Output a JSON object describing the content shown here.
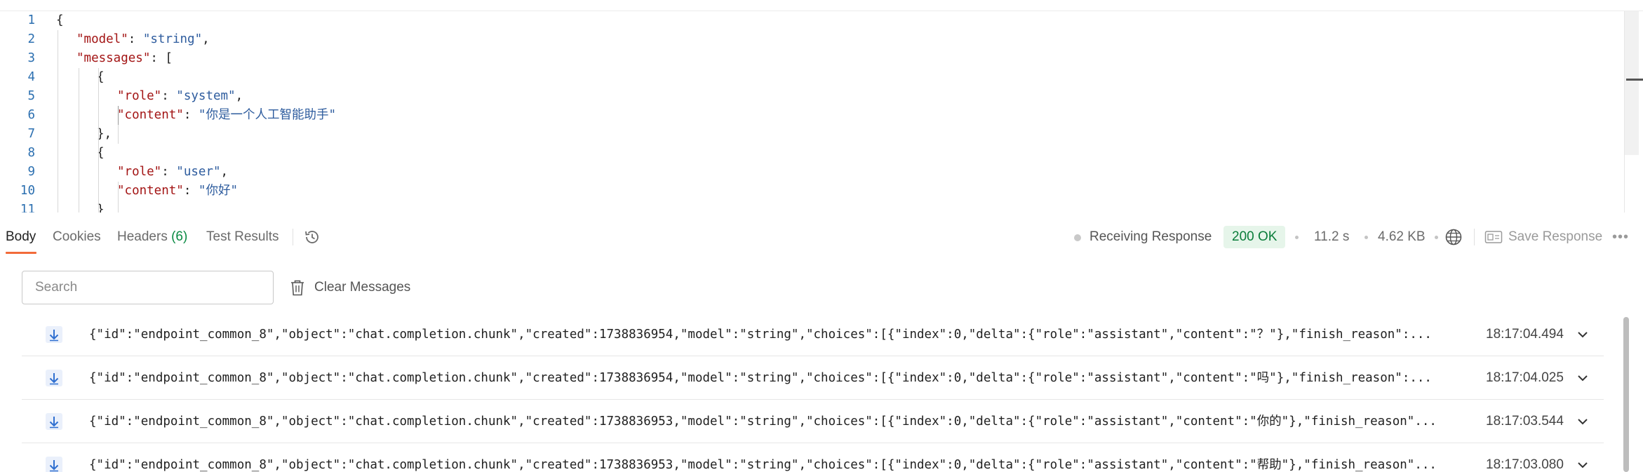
{
  "editor": {
    "lines": [
      {
        "n": "1",
        "parts": [
          {
            "t": "{",
            "c": "p"
          }
        ]
      },
      {
        "n": "2",
        "parts": [
          {
            "t": "\"model\"",
            "c": "k"
          },
          {
            "t": ": ",
            "c": "p"
          },
          {
            "t": "\"string\"",
            "c": "s"
          },
          {
            "t": ",",
            "c": "p"
          }
        ]
      },
      {
        "n": "3",
        "parts": [
          {
            "t": "\"messages\"",
            "c": "k"
          },
          {
            "t": ": [",
            "c": "p"
          }
        ]
      },
      {
        "n": "4",
        "parts": [
          {
            "t": "{",
            "c": "p"
          }
        ]
      },
      {
        "n": "5",
        "parts": [
          {
            "t": "\"role\"",
            "c": "k"
          },
          {
            "t": ": ",
            "c": "p"
          },
          {
            "t": "\"system\"",
            "c": "s"
          },
          {
            "t": ",",
            "c": "p"
          }
        ]
      },
      {
        "n": "6",
        "parts": [
          {
            "t": "\"content\"",
            "c": "k"
          },
          {
            "t": ": ",
            "c": "p"
          },
          {
            "t": "\"你是一个人工智能助手\"",
            "c": "s"
          }
        ]
      },
      {
        "n": "7",
        "parts": [
          {
            "t": "},",
            "c": "p"
          }
        ]
      },
      {
        "n": "8",
        "parts": [
          {
            "t": "{",
            "c": "p"
          }
        ]
      },
      {
        "n": "9",
        "parts": [
          {
            "t": "\"role\"",
            "c": "k"
          },
          {
            "t": ": ",
            "c": "p"
          },
          {
            "t": "\"user\"",
            "c": "s"
          },
          {
            "t": ",",
            "c": "p"
          }
        ]
      },
      {
        "n": "10",
        "parts": [
          {
            "t": "\"content\"",
            "c": "k"
          },
          {
            "t": ": ",
            "c": "p"
          },
          {
            "t": "\"你好\"",
            "c": "s"
          }
        ]
      },
      {
        "n": "11",
        "parts": [
          {
            "t": "}",
            "c": "p"
          }
        ]
      }
    ]
  },
  "tabs": {
    "body": "Body",
    "cookies": "Cookies",
    "headers": "Headers",
    "headers_count": "(6)",
    "test_results": "Test Results"
  },
  "status": {
    "receiving": "Receiving Response",
    "code": "200 OK",
    "time": "11.2 s",
    "size": "4.62 KB",
    "save_label": "Save Response"
  },
  "search": {
    "placeholder": "Search",
    "value": ""
  },
  "clear_label": "Clear Messages",
  "messages": [
    {
      "text": "{\"id\":\"endpoint_common_8\",\"object\":\"chat.completion.chunk\",\"created\":1738836954,\"model\":\"string\",\"choices\":[{\"index\":0,\"delta\":{\"role\":\"assistant\",\"content\":\"？\"},\"finish_reason\":...",
      "time": "18:17:04.494"
    },
    {
      "text": "{\"id\":\"endpoint_common_8\",\"object\":\"chat.completion.chunk\",\"created\":1738836954,\"model\":\"string\",\"choices\":[{\"index\":0,\"delta\":{\"role\":\"assistant\",\"content\":\"吗\"},\"finish_reason\":...",
      "time": "18:17:04.025"
    },
    {
      "text": "{\"id\":\"endpoint_common_8\",\"object\":\"chat.completion.chunk\",\"created\":1738836953,\"model\":\"string\",\"choices\":[{\"index\":0,\"delta\":{\"role\":\"assistant\",\"content\":\"你的\"},\"finish_reason\"...",
      "time": "18:17:03.544"
    },
    {
      "text": "{\"id\":\"endpoint_common_8\",\"object\":\"chat.completion.chunk\",\"created\":1738836953,\"model\":\"string\",\"choices\":[{\"index\":0,\"delta\":{\"role\":\"assistant\",\"content\":\"帮助\"},\"finish_reason\"...",
      "time": "18:17:03.080"
    }
  ],
  "colors": {
    "accent": "#f26b3a",
    "status_ok_bg": "#e6f5ea",
    "status_ok_text": "#0a7d3a",
    "json_key": "#a31515",
    "json_string": "#2e5c9e",
    "line_number": "#2b6fb0"
  },
  "icons": {
    "history": "history-icon",
    "globe": "globe-icon",
    "save": "save-icon",
    "more": "more-icon",
    "trash": "trash-icon",
    "arrow": "arrow-down-icon",
    "chevron": "chevron-down-icon"
  }
}
